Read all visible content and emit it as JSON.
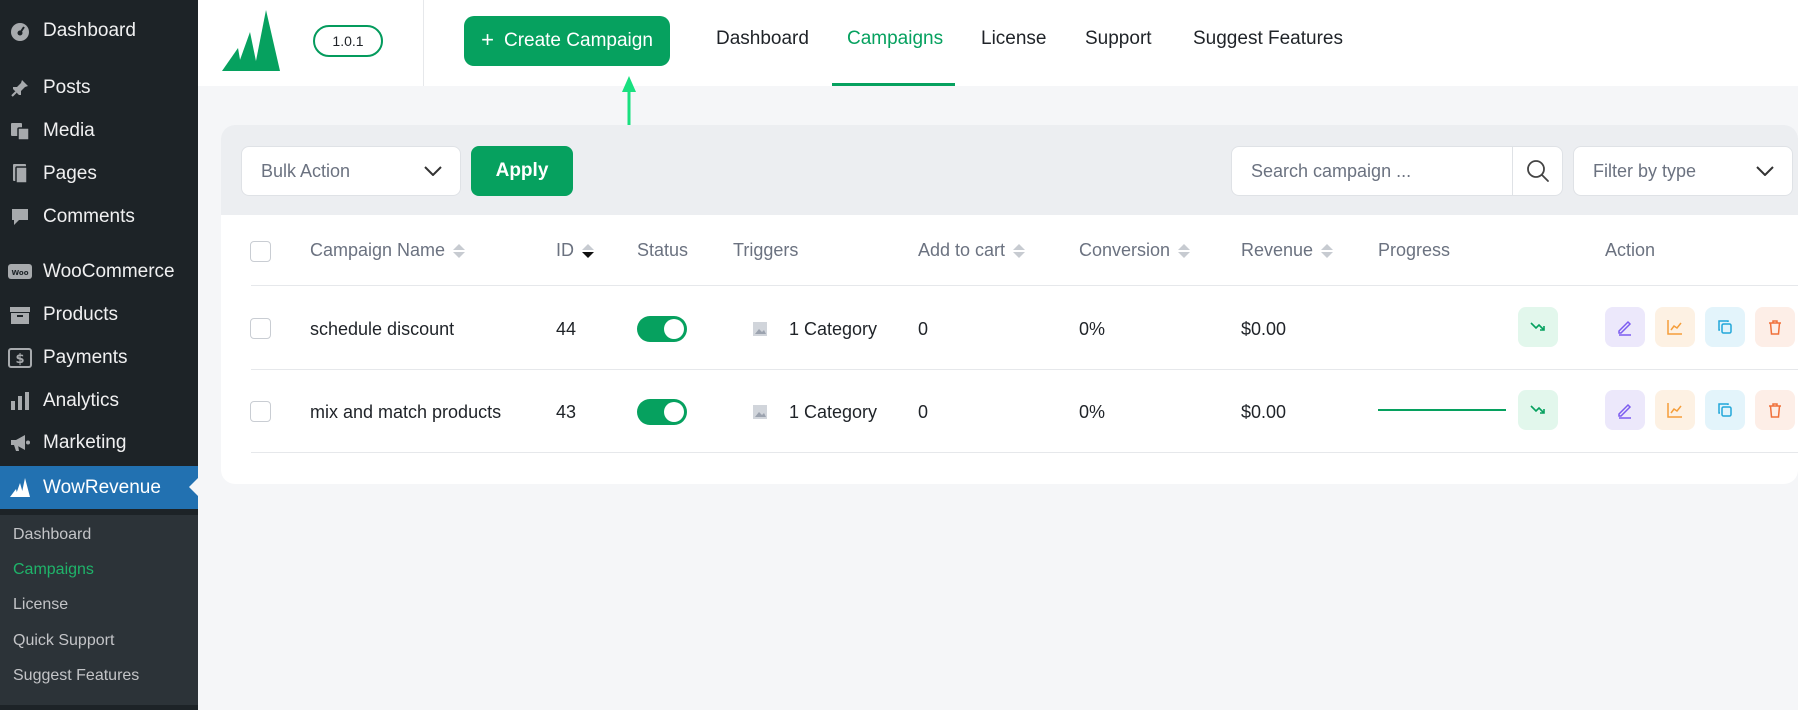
{
  "sidebar": {
    "items": [
      {
        "label": "Dashboard",
        "icon": "dashboard-icon"
      },
      {
        "label": "Posts",
        "icon": "pin-icon"
      },
      {
        "label": "Media",
        "icon": "media-icon"
      },
      {
        "label": "Pages",
        "icon": "pages-icon"
      },
      {
        "label": "Comments",
        "icon": "comment-icon"
      },
      {
        "label": "WooCommerce",
        "icon": "woo-icon"
      },
      {
        "label": "Products",
        "icon": "archive-icon"
      },
      {
        "label": "Payments",
        "icon": "dollar-icon"
      },
      {
        "label": "Analytics",
        "icon": "bar-chart-icon"
      },
      {
        "label": "Marketing",
        "icon": "megaphone-icon"
      },
      {
        "label": "WowRevenue",
        "icon": "wowrevenue-icon"
      }
    ],
    "submenu": [
      "Dashboard",
      "Campaigns",
      "License",
      "Quick Support",
      "Suggest Features"
    ]
  },
  "header": {
    "version": "1.0.1",
    "create_label": "Create Campaign",
    "nav": [
      "Dashboard",
      "Campaigns",
      "License",
      "Support",
      "Suggest Features"
    ]
  },
  "toolbar": {
    "bulk_action": "Bulk Action",
    "apply": "Apply",
    "search_placeholder": "Search campaign ...",
    "filter": "Filter by type"
  },
  "table": {
    "columns": [
      "Campaign Name",
      "ID",
      "Status",
      "Triggers",
      "Add to cart",
      "Conversion",
      "Revenue",
      "Progress",
      "Action"
    ],
    "rows": [
      {
        "name": "schedule discount",
        "id": "44",
        "trigger": "1 Category",
        "add_to_cart": "0",
        "conversion": "0%",
        "revenue": "$0.00"
      },
      {
        "name": "mix and match products",
        "id": "43",
        "trigger": "1 Category",
        "add_to_cart": "0",
        "conversion": "0%",
        "revenue": "$0.00"
      }
    ]
  },
  "colors": {
    "brand": "#06a15f",
    "wp_sidebar": "#1d2327",
    "wp_active": "#2271b1"
  }
}
